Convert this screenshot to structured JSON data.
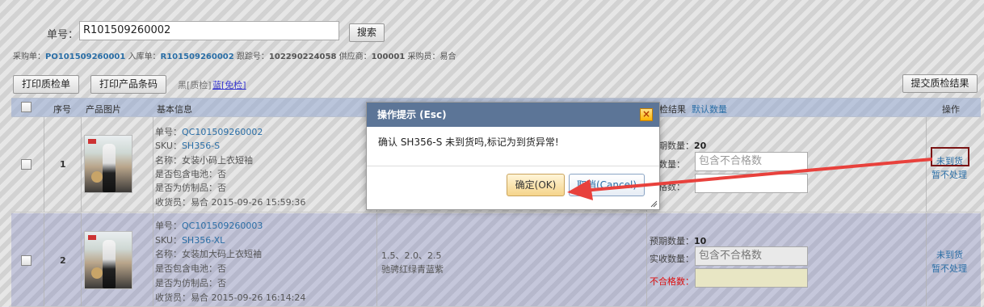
{
  "search": {
    "order_label": "单号：",
    "order_value": "R101509260002",
    "search_button": "搜索"
  },
  "summary": {
    "po_label": "采购单：",
    "po_value": "PO101509260001",
    "in_label": "入库单：",
    "in_value": "R101509260002",
    "track_label": "跟踪号：",
    "track_value": "102290224058",
    "supplier_label": "供应商：",
    "supplier_value": "100001",
    "buyer_label": "采购员：",
    "buyer_value": "易合"
  },
  "toolbar": {
    "print_qc": "打印质检单",
    "print_barcode": "打印产品条码",
    "black_label": "黑[质检]",
    "blue_label": "蓝[免检]",
    "submit": "提交质检结果"
  },
  "table": {
    "headers": {
      "seq": "序号",
      "image": "产品图片",
      "basic": "基本信息",
      "result": "检结果",
      "default_qty": "默认数量",
      "op": "操作"
    },
    "rows": [
      {
        "seq": "1",
        "order_label": "单号：",
        "order": "QC101509260002",
        "sku_label": "SKU：",
        "sku": "SH356-S",
        "name": "名称：女装小码上衣短袖",
        "battery": "是否包含电池：否",
        "replica": "是否为仿制品：否",
        "receiver": "收货员：易合 2015-09-26 15:59:36",
        "attrs": "",
        "color": "",
        "expected_label": "预期数量：",
        "expected": "20",
        "actual_label": "收数量：",
        "actual_placeholder": "包含不合格数",
        "bad_label": "合格数：",
        "op_not_arrived": "未到货",
        "op_skip": "暂不处理"
      },
      {
        "seq": "2",
        "order_label": "单号：",
        "order": "QC101509260003",
        "sku_label": "SKU：",
        "sku": "SH356-XL",
        "name": "名称：女装加大码上衣短袖",
        "battery": "是否包含电池：否",
        "replica": "是否为仿制品：否",
        "receiver": "收货员：易合 2015-09-26 16:14:24",
        "attrs": "1.5、2.0、2.5",
        "color": "驰骋红绿青蓝紫",
        "expected_label": "预期数量：",
        "expected": "10",
        "actual_label": "实收数量：",
        "actual_placeholder": "包含不合格数",
        "bad_label": "不合格数：",
        "op_not_arrived": "未到货",
        "op_skip": "暂不处理"
      }
    ]
  },
  "dialog": {
    "title": "操作提示 (Esc)",
    "close": "×",
    "message": "确认 SH356-S 未到货吗,标记为到货异常!",
    "ok": "确定(OK)",
    "cancel": "取消(Cancel)"
  },
  "colors": {
    "arrow": "#e8413c",
    "highlight": "#7a1414",
    "dialog_title": "#5c7597"
  }
}
